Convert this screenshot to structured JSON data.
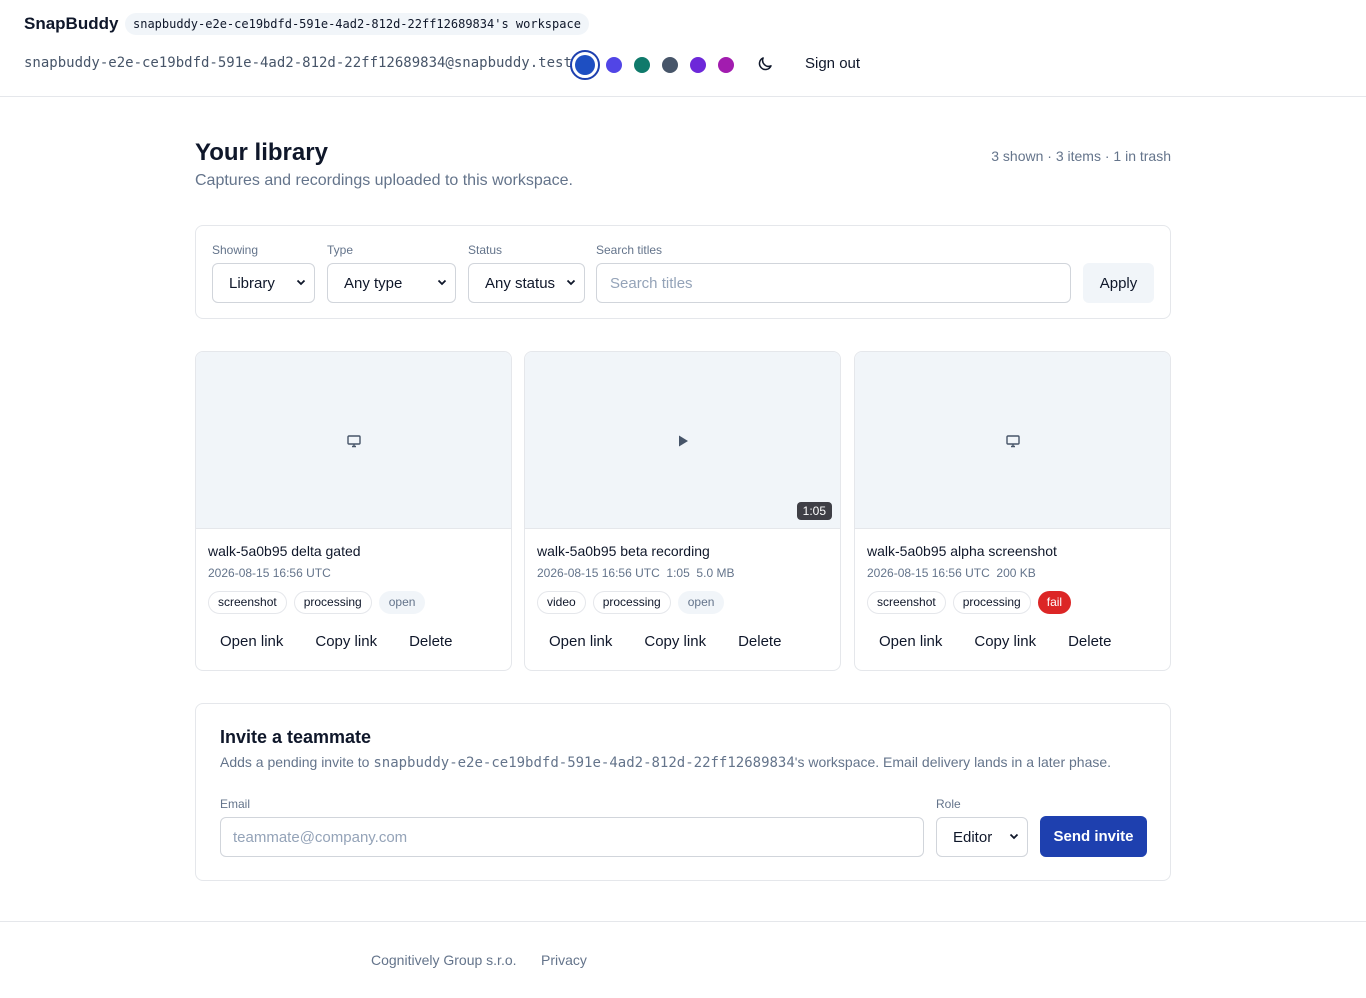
{
  "header": {
    "brand": "SnapBuddy",
    "workspace_badge": "snapbuddy-e2e-ce19bdfd-591e-4ad2-812d-22ff12689834's workspace",
    "user_email": "snapbuddy-e2e-ce19bdfd-591e-4ad2-812d-22ff12689834@snapbuddy.test",
    "theme_colors": [
      "#1e4fc2",
      "#5145e6",
      "#0f7a6b",
      "#475569",
      "#6d28d9",
      "#a21caf"
    ],
    "theme_toggle_icon": "moon-icon",
    "sign_out": "Sign out"
  },
  "library": {
    "title": "Your library",
    "subtitle": "Captures and recordings uploaded to this workspace.",
    "counts": "3 shown · 3 items · 1 in trash"
  },
  "filters": {
    "showing_label": "Showing",
    "showing_value": "Library",
    "type_label": "Type",
    "type_value": "Any type",
    "status_label": "Status",
    "status_value": "Any status",
    "search_label": "Search titles",
    "search_placeholder": "Search titles",
    "apply": "Apply"
  },
  "cards": [
    {
      "thumb_icon": "monitor-icon",
      "title": "walk-5a0b95 delta gated",
      "meta": "2026-08-15 16:56 UTC",
      "tags": [
        "screenshot",
        "processing",
        "open"
      ],
      "actions": [
        "Open link",
        "Copy link",
        "Delete"
      ]
    },
    {
      "thumb_icon": "play-icon",
      "duration": "1:05",
      "title": "walk-5a0b95 beta recording",
      "meta": "2026-08-15 16:56 UTC  1:05  5.0 MB",
      "tags": [
        "video",
        "processing",
        "open"
      ],
      "actions": [
        "Open link",
        "Copy link",
        "Delete"
      ]
    },
    {
      "thumb_icon": "monitor-icon",
      "title": "walk-5a0b95 alpha screenshot",
      "meta": "2026-08-15 16:56 UTC  200 KB",
      "tags": [
        "screenshot",
        "processing",
        "fail"
      ],
      "actions": [
        "Open link",
        "Copy link",
        "Delete"
      ]
    }
  ],
  "invite": {
    "title": "Invite a teammate",
    "desc_prefix": "Adds a pending invite to ",
    "desc_workspace": "snapbuddy-e2e-ce19bdfd-591e-4ad2-812d-22ff12689834",
    "desc_suffix": "'s workspace. Email delivery lands in a later phase.",
    "email_label": "Email",
    "email_placeholder": "teammate@company.com",
    "role_label": "Role",
    "role_value": "Editor",
    "send": "Send invite"
  },
  "footer": {
    "company": "Cognitively Group s.r.o.",
    "privacy": "Privacy"
  }
}
